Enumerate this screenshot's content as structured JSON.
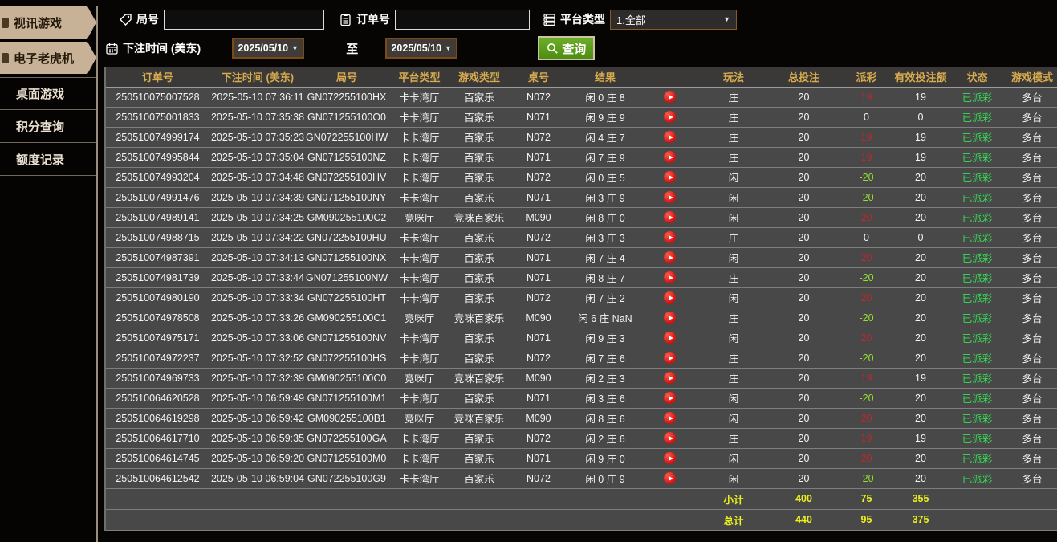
{
  "colors": {
    "sidebar_active_tan": "#c7b197",
    "header_gold": "#d8ab4e",
    "payout_positive_red": "#c1262e",
    "payout_negative_green": "#8fe030",
    "status_green": "#35df55",
    "totals_yellow": "#eaf119",
    "search_button_green": "#5a9e1e",
    "date_border_brown": "#7d4a17"
  },
  "sidebar": {
    "items": [
      {
        "label": "视讯游戏",
        "active": true
      },
      {
        "label": "电子老虎机",
        "active": true
      },
      {
        "label": "桌面游戏",
        "active": false
      },
      {
        "label": "积分查询",
        "active": false
      },
      {
        "label": "额度记录",
        "active": false
      }
    ]
  },
  "filters": {
    "round_label": "局号",
    "round_value": "",
    "order_label": "订单号",
    "order_value": "",
    "platform_label": "平台类型",
    "platform_value": "1.全部",
    "time_label": "下注时间 (美东)",
    "date_from": "2025/05/10",
    "to_label": "至",
    "date_to": "2025/05/10",
    "search_label": "查询"
  },
  "table": {
    "headers": [
      "订单号",
      "下注时间 (美东)",
      "局号",
      "平台类型",
      "游戏类型",
      "桌号",
      "结果",
      "",
      "玩法",
      "总投注",
      "派彩",
      "有效投注额",
      "状态",
      "游戏模式"
    ],
    "rows": [
      {
        "order": "250510075007528",
        "time": "2025-05-10 07:36:11",
        "round": "GN072255100HX",
        "platform": "卡卡湾厅",
        "game": "百家乐",
        "table_no": "N072",
        "result": "闲 0 庄 8",
        "play": "庄",
        "total": "20",
        "payout": "19",
        "valid": "19",
        "status": "已派彩",
        "mode": "多台"
      },
      {
        "order": "250510075001833",
        "time": "2025-05-10 07:35:38",
        "round": "GN071255100O0",
        "platform": "卡卡湾厅",
        "game": "百家乐",
        "table_no": "N071",
        "result": "闲 9 庄 9",
        "play": "庄",
        "total": "20",
        "payout": "0",
        "valid": "0",
        "status": "已派彩",
        "mode": "多台"
      },
      {
        "order": "250510074999174",
        "time": "2025-05-10 07:35:23",
        "round": "GN072255100HW",
        "platform": "卡卡湾厅",
        "game": "百家乐",
        "table_no": "N072",
        "result": "闲 4 庄 7",
        "play": "庄",
        "total": "20",
        "payout": "19",
        "valid": "19",
        "status": "已派彩",
        "mode": "多台"
      },
      {
        "order": "250510074995844",
        "time": "2025-05-10 07:35:04",
        "round": "GN071255100NZ",
        "platform": "卡卡湾厅",
        "game": "百家乐",
        "table_no": "N071",
        "result": "闲 7 庄 9",
        "play": "庄",
        "total": "20",
        "payout": "19",
        "valid": "19",
        "status": "已派彩",
        "mode": "多台"
      },
      {
        "order": "250510074993204",
        "time": "2025-05-10 07:34:48",
        "round": "GN072255100HV",
        "platform": "卡卡湾厅",
        "game": "百家乐",
        "table_no": "N072",
        "result": "闲 0 庄 5",
        "play": "闲",
        "total": "20",
        "payout": "-20",
        "valid": "20",
        "status": "已派彩",
        "mode": "多台"
      },
      {
        "order": "250510074991476",
        "time": "2025-05-10 07:34:39",
        "round": "GN071255100NY",
        "platform": "卡卡湾厅",
        "game": "百家乐",
        "table_no": "N071",
        "result": "闲 3 庄 9",
        "play": "闲",
        "total": "20",
        "payout": "-20",
        "valid": "20",
        "status": "已派彩",
        "mode": "多台"
      },
      {
        "order": "250510074989141",
        "time": "2025-05-10 07:34:25",
        "round": "GM090255100C2",
        "platform": "竞咪厅",
        "game": "竞咪百家乐",
        "table_no": "M090",
        "result": "闲 8 庄 0",
        "play": "闲",
        "total": "20",
        "payout": "20",
        "valid": "20",
        "status": "已派彩",
        "mode": "多台"
      },
      {
        "order": "250510074988715",
        "time": "2025-05-10 07:34:22",
        "round": "GN072255100HU",
        "platform": "卡卡湾厅",
        "game": "百家乐",
        "table_no": "N072",
        "result": "闲 3 庄 3",
        "play": "庄",
        "total": "20",
        "payout": "0",
        "valid": "0",
        "status": "已派彩",
        "mode": "多台"
      },
      {
        "order": "250510074987391",
        "time": "2025-05-10 07:34:13",
        "round": "GN071255100NX",
        "platform": "卡卡湾厅",
        "game": "百家乐",
        "table_no": "N071",
        "result": "闲 7 庄 4",
        "play": "闲",
        "total": "20",
        "payout": "20",
        "valid": "20",
        "status": "已派彩",
        "mode": "多台"
      },
      {
        "order": "250510074981739",
        "time": "2025-05-10 07:33:44",
        "round": "GN071255100NW",
        "platform": "卡卡湾厅",
        "game": "百家乐",
        "table_no": "N071",
        "result": "闲 8 庄 7",
        "play": "庄",
        "total": "20",
        "payout": "-20",
        "valid": "20",
        "status": "已派彩",
        "mode": "多台"
      },
      {
        "order": "250510074980190",
        "time": "2025-05-10 07:33:34",
        "round": "GN072255100HT",
        "platform": "卡卡湾厅",
        "game": "百家乐",
        "table_no": "N072",
        "result": "闲 7 庄 2",
        "play": "闲",
        "total": "20",
        "payout": "20",
        "valid": "20",
        "status": "已派彩",
        "mode": "多台"
      },
      {
        "order": "250510074978508",
        "time": "2025-05-10 07:33:26",
        "round": "GM090255100C1",
        "platform": "竞咪厅",
        "game": "竞咪百家乐",
        "table_no": "M090",
        "result": "闲 6 庄 NaN",
        "play": "庄",
        "total": "20",
        "payout": "-20",
        "valid": "20",
        "status": "已派彩",
        "mode": "多台"
      },
      {
        "order": "250510074975171",
        "time": "2025-05-10 07:33:06",
        "round": "GN071255100NV",
        "platform": "卡卡湾厅",
        "game": "百家乐",
        "table_no": "N071",
        "result": "闲 9 庄 3",
        "play": "闲",
        "total": "20",
        "payout": "20",
        "valid": "20",
        "status": "已派彩",
        "mode": "多台"
      },
      {
        "order": "250510074972237",
        "time": "2025-05-10 07:32:52",
        "round": "GN072255100HS",
        "platform": "卡卡湾厅",
        "game": "百家乐",
        "table_no": "N072",
        "result": "闲 7 庄 6",
        "play": "庄",
        "total": "20",
        "payout": "-20",
        "valid": "20",
        "status": "已派彩",
        "mode": "多台"
      },
      {
        "order": "250510074969733",
        "time": "2025-05-10 07:32:39",
        "round": "GM090255100C0",
        "platform": "竞咪厅",
        "game": "竞咪百家乐",
        "table_no": "M090",
        "result": "闲 2 庄 3",
        "play": "庄",
        "total": "20",
        "payout": "19",
        "valid": "19",
        "status": "已派彩",
        "mode": "多台"
      },
      {
        "order": "250510064620528",
        "time": "2025-05-10 06:59:49",
        "round": "GN071255100M1",
        "platform": "卡卡湾厅",
        "game": "百家乐",
        "table_no": "N071",
        "result": "闲 3 庄 6",
        "play": "闲",
        "total": "20",
        "payout": "-20",
        "valid": "20",
        "status": "已派彩",
        "mode": "多台"
      },
      {
        "order": "250510064619298",
        "time": "2025-05-10 06:59:42",
        "round": "GM090255100B1",
        "platform": "竞咪厅",
        "game": "竞咪百家乐",
        "table_no": "M090",
        "result": "闲 8 庄 6",
        "play": "闲",
        "total": "20",
        "payout": "20",
        "valid": "20",
        "status": "已派彩",
        "mode": "多台"
      },
      {
        "order": "250510064617710",
        "time": "2025-05-10 06:59:35",
        "round": "GN072255100GA",
        "platform": "卡卡湾厅",
        "game": "百家乐",
        "table_no": "N072",
        "result": "闲 2 庄 6",
        "play": "庄",
        "total": "20",
        "payout": "19",
        "valid": "19",
        "status": "已派彩",
        "mode": "多台"
      },
      {
        "order": "250510064614745",
        "time": "2025-05-10 06:59:20",
        "round": "GN071255100M0",
        "platform": "卡卡湾厅",
        "game": "百家乐",
        "table_no": "N071",
        "result": "闲 9 庄 0",
        "play": "闲",
        "total": "20",
        "payout": "20",
        "valid": "20",
        "status": "已派彩",
        "mode": "多台"
      },
      {
        "order": "250510064612542",
        "time": "2025-05-10 06:59:04",
        "round": "GN072255100G9",
        "platform": "卡卡湾厅",
        "game": "百家乐",
        "table_no": "N072",
        "result": "闲 0 庄 9",
        "play": "闲",
        "total": "20",
        "payout": "-20",
        "valid": "20",
        "status": "已派彩",
        "mode": "多台"
      }
    ],
    "subtotal": {
      "label": "小计",
      "total": "400",
      "payout": "75",
      "valid": "355"
    },
    "grand_total": {
      "label": "总计",
      "total": "440",
      "payout": "95",
      "valid": "375"
    }
  }
}
